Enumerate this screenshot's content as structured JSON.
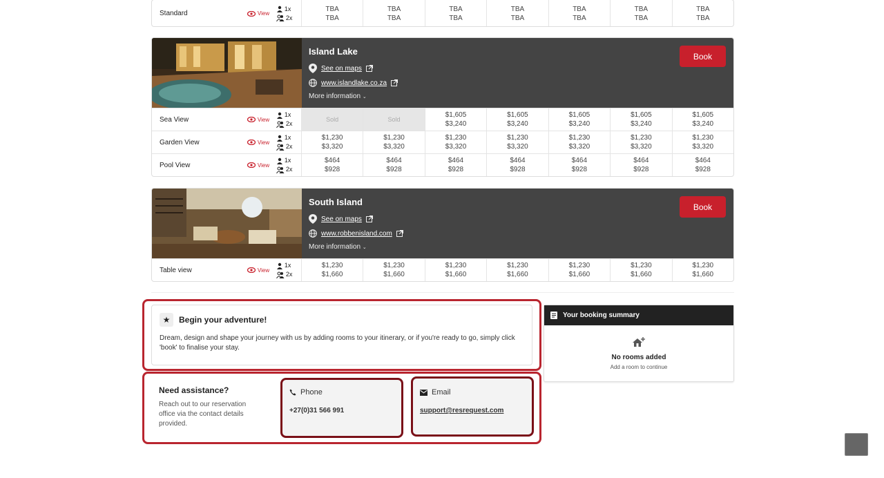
{
  "top_card": {
    "room": "Standard",
    "view_label": "View",
    "occ1": "1x",
    "occ2": "2x",
    "cells": [
      [
        "TBA",
        "TBA"
      ],
      [
        "TBA",
        "TBA"
      ],
      [
        "TBA",
        "TBA"
      ],
      [
        "TBA",
        "TBA"
      ],
      [
        "TBA",
        "TBA"
      ],
      [
        "TBA",
        "TBA"
      ],
      [
        "TBA",
        "TBA"
      ]
    ]
  },
  "island_lake": {
    "name": "Island Lake",
    "maps_label": "See on maps",
    "website": "www.islandlake.co.za",
    "more_info": "More information",
    "book_label": "Book",
    "rooms": [
      {
        "name": "Sea View",
        "cells": [
          [
            "Sold",
            ""
          ],
          [
            "Sold",
            ""
          ],
          [
            "$1,605",
            "$3,240"
          ],
          [
            "$1,605",
            "$3,240"
          ],
          [
            "$1,605",
            "$3,240"
          ],
          [
            "$1,605",
            "$3,240"
          ],
          [
            "$1,605",
            "$3,240"
          ]
        ]
      },
      {
        "name": "Garden View",
        "cells": [
          [
            "$1,230",
            "$3,320"
          ],
          [
            "$1,230",
            "$3,320"
          ],
          [
            "$1,230",
            "$3,320"
          ],
          [
            "$1,230",
            "$3,320"
          ],
          [
            "$1,230",
            "$3,320"
          ],
          [
            "$1,230",
            "$3,320"
          ],
          [
            "$1,230",
            "$3,320"
          ]
        ]
      },
      {
        "name": "Pool View",
        "cells": [
          [
            "$464",
            "$928"
          ],
          [
            "$464",
            "$928"
          ],
          [
            "$464",
            "$928"
          ],
          [
            "$464",
            "$928"
          ],
          [
            "$464",
            "$928"
          ],
          [
            "$464",
            "$928"
          ],
          [
            "$464",
            "$928"
          ]
        ]
      }
    ]
  },
  "south_island": {
    "name": "South Island",
    "maps_label": "See on maps",
    "website": "www.robbenisland.com",
    "more_info": "More information",
    "book_label": "Book",
    "rooms": [
      {
        "name": "Table view",
        "cells": [
          [
            "$1,230",
            "$1,660"
          ],
          [
            "$1,230",
            "$1,660"
          ],
          [
            "$1,230",
            "$1,660"
          ],
          [
            "$1,230",
            "$1,660"
          ],
          [
            "$1,230",
            "$1,660"
          ],
          [
            "$1,230",
            "$1,660"
          ],
          [
            "$1,230",
            "$1,660"
          ]
        ]
      }
    ]
  },
  "view_label": "View",
  "occ1": "1x",
  "occ2": "2x",
  "adventure": {
    "title": "Begin your adventure!",
    "text": "Dream, design and shape your journey with us by adding rooms to your itinerary, or if you're ready to go, simply click 'book' to finalise your stay."
  },
  "assistance": {
    "title": "Need assistance?",
    "text": "Reach out to our reservation office via the contact details provided.",
    "phone_label": "Phone",
    "phone_value": "+27(0)31 566 991",
    "email_label": "Email",
    "email_value": "support@resrequest.com"
  },
  "summary": {
    "title": "Your booking summary",
    "empty_title": "No rooms added",
    "empty_sub": "Add a room to continue"
  },
  "colors": {
    "accent": "#c8202c",
    "header_bg": "#444444"
  },
  "icons": [
    "eye-icon",
    "person-icon",
    "people-icon",
    "map-pin-icon",
    "external-link-icon",
    "globe-icon",
    "chevron-down-icon",
    "star-icon",
    "phone-icon",
    "mail-icon",
    "list-icon",
    "house-plus-icon"
  ]
}
